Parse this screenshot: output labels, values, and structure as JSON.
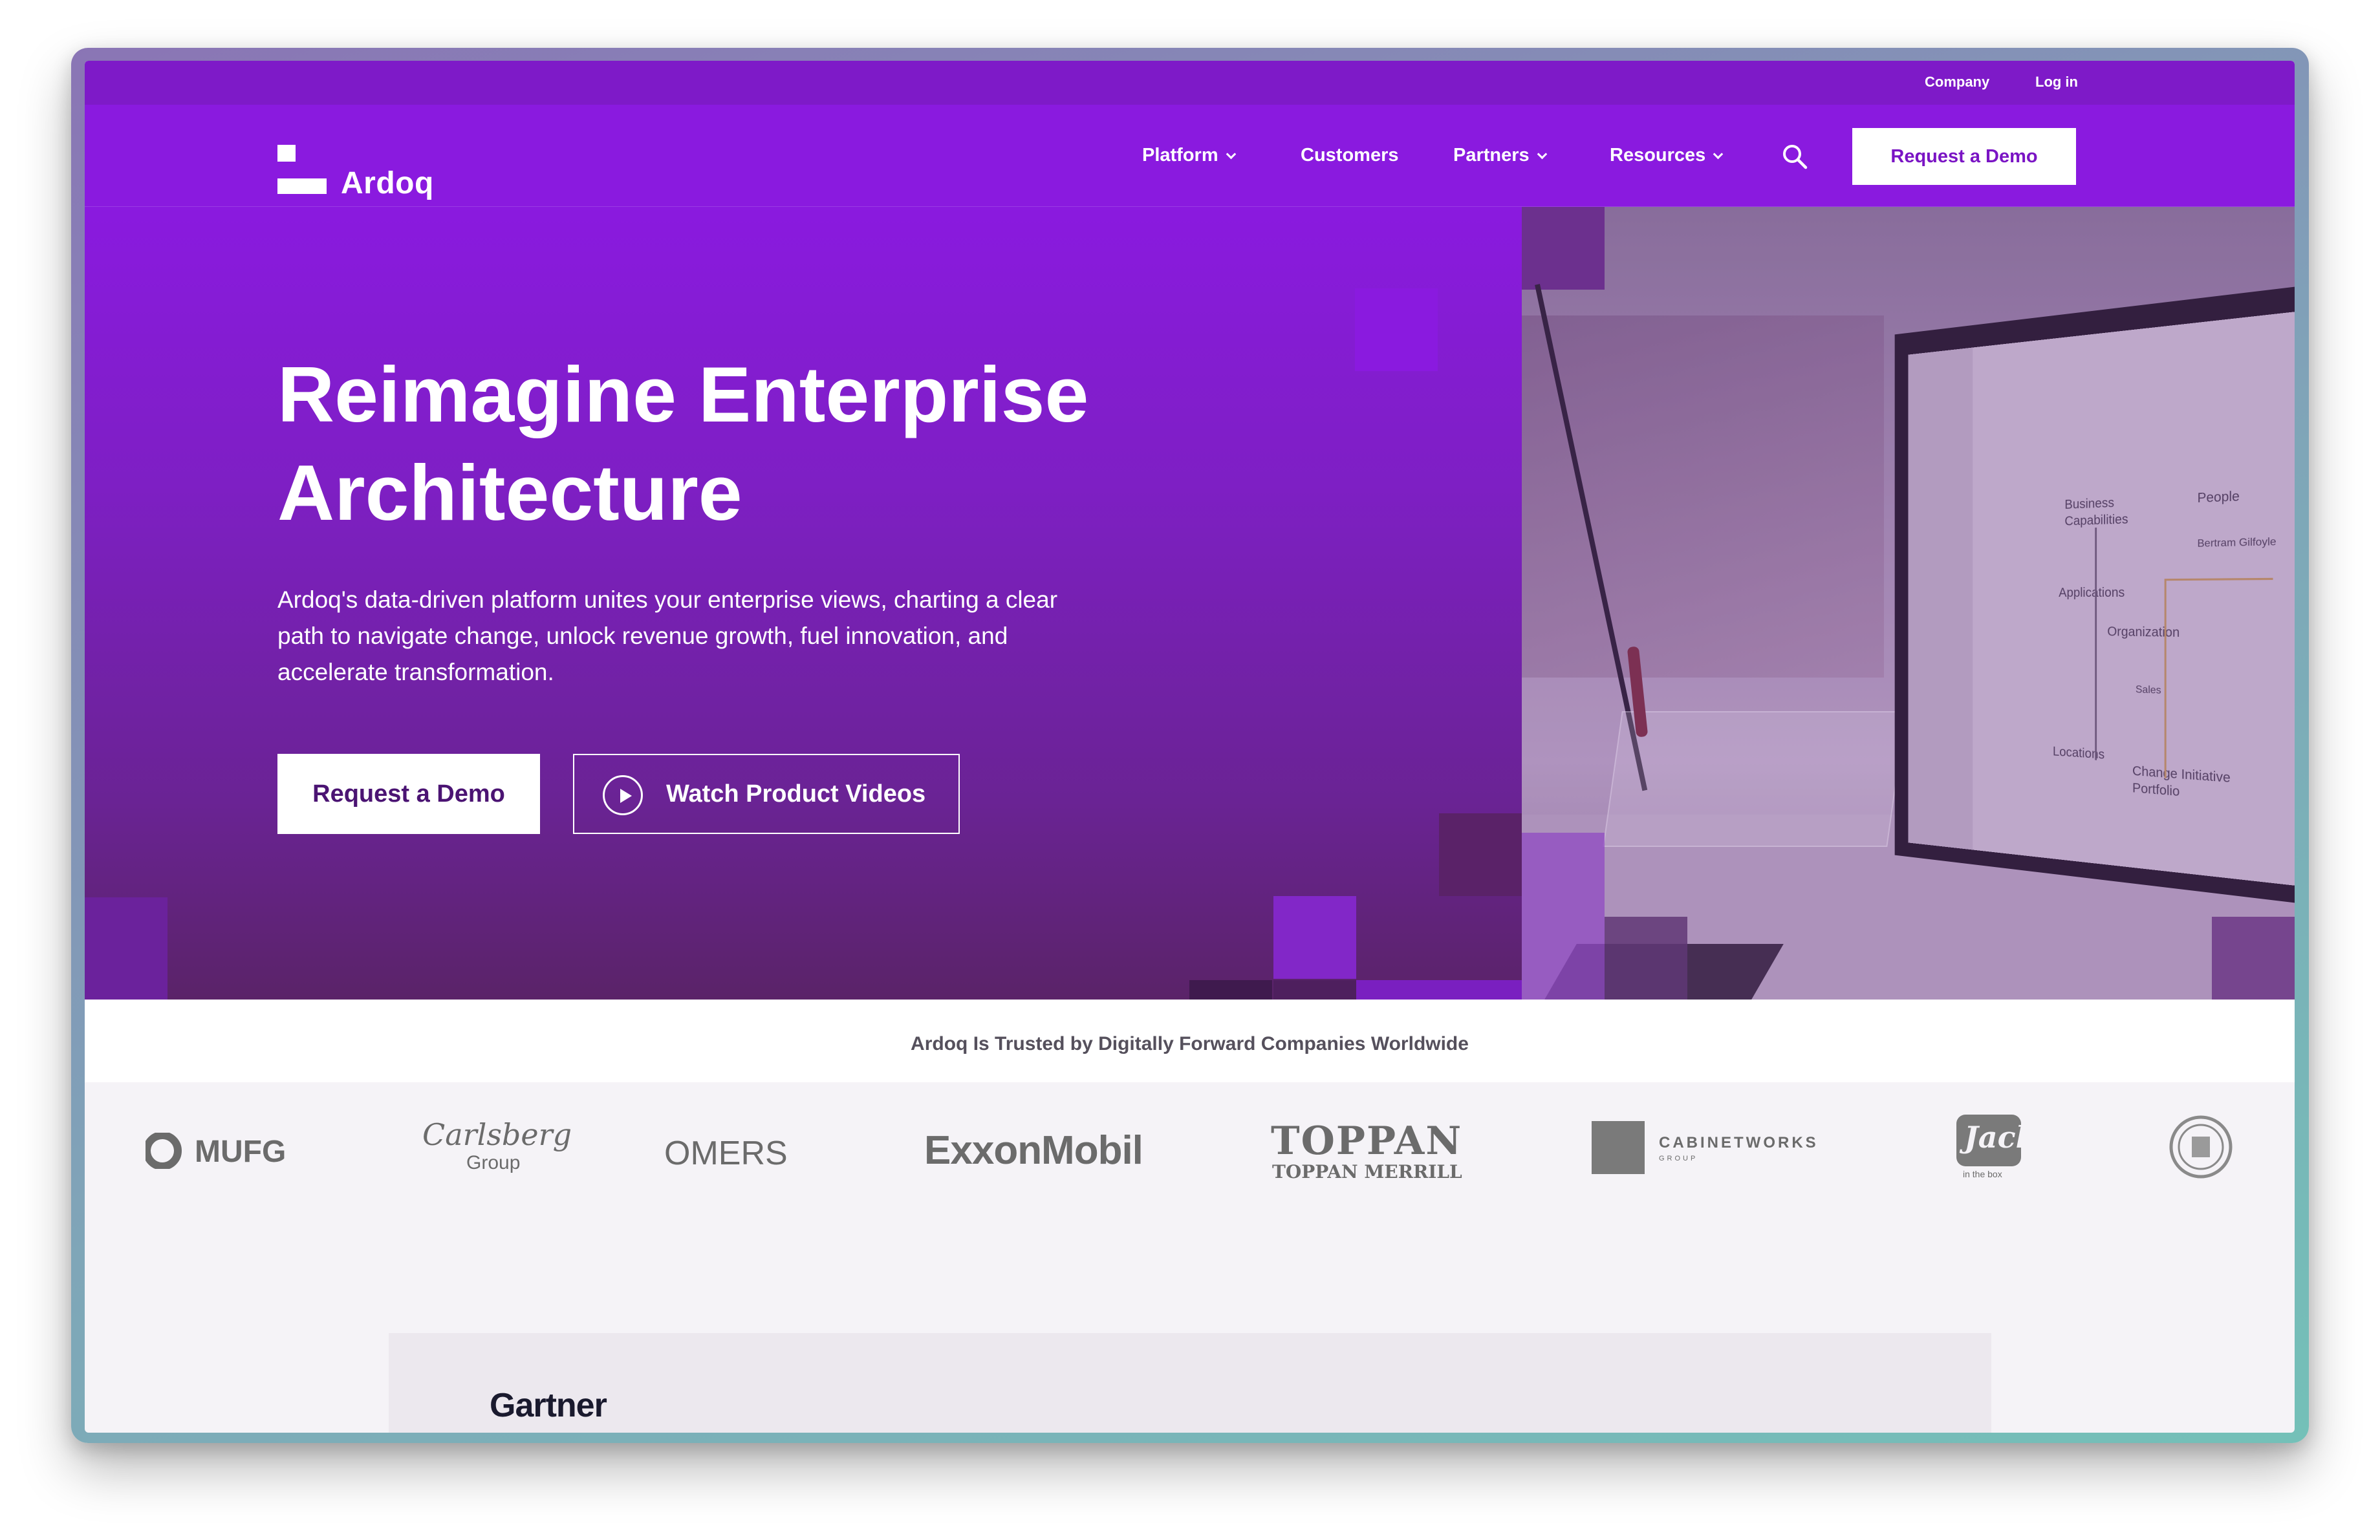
{
  "utility": {
    "company": "Company",
    "login": "Log in"
  },
  "nav": {
    "logo": "Ardoq",
    "platform": "Platform",
    "customers": "Customers",
    "partners": "Partners",
    "resources": "Resources",
    "request_demo": "Request a Demo"
  },
  "hero": {
    "title_line1": "Reimagine Enterprise",
    "title_line2": "Architecture",
    "subtitle_line1": "Ardoq's data-driven platform unites your enterprise views, charting a clear",
    "subtitle_line2": "path to navigate change, unlock revenue growth, fuel innovation, and",
    "subtitle_line3": "accelerate transformation.",
    "cta_demo": "Request a Demo",
    "cta_videos": "Watch Product Videos"
  },
  "screen_ui": {
    "business_capabilities_1": "Business",
    "business_capabilities_2": "Capabilities",
    "people": "People",
    "person": "Bertram Gilfoyle",
    "applications": "Applications",
    "organization": "Organization",
    "sales": "Sales",
    "locations": "Locations",
    "change_initiative_1": "Change Initiative",
    "change_initiative_2": "Portfolio"
  },
  "trusted": {
    "heading": "Ardoq Is Trusted by Digitally Forward Companies Worldwide",
    "logos": {
      "mufg": "MUFG",
      "carlsberg": "Carlsberg",
      "carlsberg_group": "Group",
      "omers": "OMERS",
      "exxonmobil": "ExxonMobil",
      "toppan": "TOPPAN",
      "toppan_merrill": "TOPPAN MERRILL",
      "cabinetworks": "CABINETWORKS",
      "cabinetworks_group": "GROUP",
      "jack": "Jack",
      "jack_sub": "in the box"
    }
  },
  "gartner": {
    "label": "Gartner"
  },
  "colors": {
    "brand_purple": "#8a1adf",
    "dark_purple": "#4b1473"
  }
}
